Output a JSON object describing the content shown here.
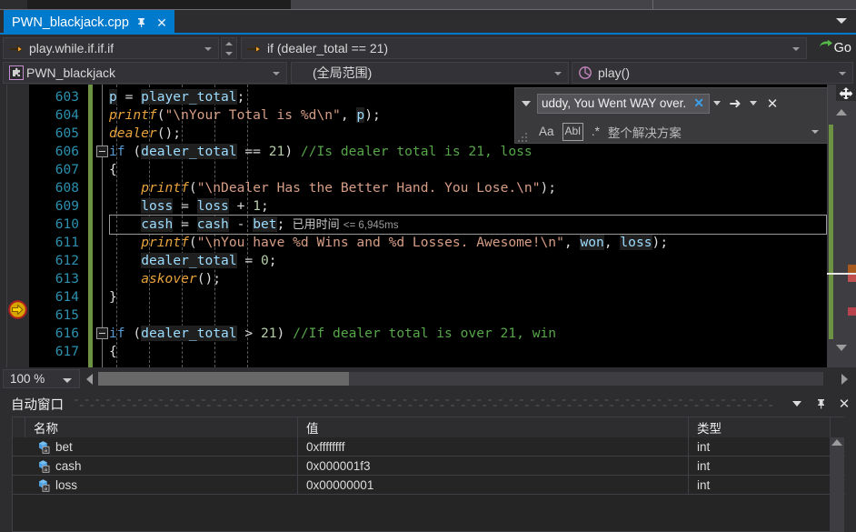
{
  "window": {
    "tab": {
      "title": "PWN_blackjack.cpp",
      "pin_icon": "pin-icon",
      "close_icon": "close-icon"
    },
    "tab_list_caret": "chevron-down-icon"
  },
  "navbar": {
    "row1": {
      "scope_icon": "orange-arrow-icon",
      "scope_value": "play.while.if.if.if",
      "member_icon": "orange-arrow-icon",
      "member_value": "if (dealer_total == 21)",
      "go_label": "Go",
      "go_icon": "green-go-arrow-icon"
    },
    "row2": {
      "project_icon": "project-puzzle-icon",
      "project_value": "PWN_blackjack",
      "scope_value": "(全局范围)",
      "method_icon": "method-icon",
      "method_value": "play()"
    }
  },
  "find": {
    "expand_icon": "chevron-down-icon",
    "query": "uddy, You Went WAY over.",
    "clear_icon": "clear-x-icon",
    "history_icon": "chevron-down-icon",
    "find_next_icon": "arrow-right-icon",
    "options_icon": "chevron-down-icon",
    "close_icon": "close-icon",
    "match_case_label": "Aa",
    "match_word_label": "Abl",
    "regex_label": ".*",
    "scope_label": "整个解决方案",
    "scope_caret_icon": "chevron-down-icon"
  },
  "editor": {
    "zoom_level": "100 %",
    "current_line": 610,
    "breakpoint_line": 610,
    "fold_lines": [
      606,
      616
    ],
    "lines": [
      {
        "n": 603,
        "tokens": [
          {
            "t": "idn",
            "s": "p"
          },
          {
            "t": "pun",
            "s": " = "
          },
          {
            "t": "idn",
            "s": "player_total"
          },
          {
            "t": "pun",
            "s": ";"
          }
        ]
      },
      {
        "n": 604,
        "tokens": [
          {
            "t": "fnc",
            "s": "printf"
          },
          {
            "t": "pun",
            "s": "("
          },
          {
            "t": "str",
            "s": "\"\\nYour Total is %d\\n\""
          },
          {
            "t": "pun",
            "s": ", "
          },
          {
            "t": "idn",
            "s": "p"
          },
          {
            "t": "pun",
            "s": ");"
          }
        ]
      },
      {
        "n": 605,
        "tokens": [
          {
            "t": "fnc",
            "s": "dealer"
          },
          {
            "t": "pun",
            "s": "();"
          }
        ]
      },
      {
        "n": 606,
        "tokens": [
          {
            "t": "kw",
            "s": "if"
          },
          {
            "t": "pun",
            "s": " ("
          },
          {
            "t": "idn",
            "s": "dealer_total"
          },
          {
            "t": "pun",
            "s": " == "
          },
          {
            "t": "num",
            "s": "21"
          },
          {
            "t": "pun",
            "s": ") "
          },
          {
            "t": "cmt",
            "s": "//Is dealer total is 21, loss"
          }
        ]
      },
      {
        "n": 607,
        "tokens": [
          {
            "t": "pun",
            "s": "{"
          }
        ]
      },
      {
        "n": 608,
        "indent": 4,
        "tokens": [
          {
            "t": "fnc",
            "s": "printf"
          },
          {
            "t": "pun",
            "s": "("
          },
          {
            "t": "str",
            "s": "\"\\nDealer Has the Better Hand. You Lose.\\n\""
          },
          {
            "t": "pun",
            "s": ");"
          }
        ]
      },
      {
        "n": 609,
        "indent": 4,
        "tokens": [
          {
            "t": "idn",
            "s": "loss"
          },
          {
            "t": "pun",
            "s": " = "
          },
          {
            "t": "idn",
            "s": "loss"
          },
          {
            "t": "pun",
            "s": " + "
          },
          {
            "t": "num",
            "s": "1"
          },
          {
            "t": "pun",
            "s": ";"
          }
        ]
      },
      {
        "n": 610,
        "indent": 4,
        "tokens": [
          {
            "t": "idn",
            "s": "cash"
          },
          {
            "t": "pun",
            "s": " = "
          },
          {
            "t": "idn",
            "s": "cash"
          },
          {
            "t": "pun",
            "s": " - "
          },
          {
            "t": "idn",
            "s": "bet"
          },
          {
            "t": "pun",
            "s": ";"
          }
        ]
      },
      {
        "n": 611,
        "indent": 4,
        "tokens": [
          {
            "t": "fnc",
            "s": "printf"
          },
          {
            "t": "pun",
            "s": "("
          },
          {
            "t": "str",
            "s": "\"\\nYou have %d Wins and %d Losses. Awesome!\\n\""
          },
          {
            "t": "pun",
            "s": ", "
          },
          {
            "t": "idn",
            "s": "won"
          },
          {
            "t": "pun",
            "s": ", "
          },
          {
            "t": "idn",
            "s": "loss"
          },
          {
            "t": "pun",
            "s": ");"
          }
        ]
      },
      {
        "n": 612,
        "indent": 4,
        "tokens": [
          {
            "t": "idn",
            "s": "dealer_total"
          },
          {
            "t": "pun",
            "s": " = "
          },
          {
            "t": "num",
            "s": "0"
          },
          {
            "t": "pun",
            "s": ";"
          }
        ]
      },
      {
        "n": 613,
        "indent": 4,
        "tokens": [
          {
            "t": "fnc",
            "s": "askover"
          },
          {
            "t": "pun",
            "s": "();"
          }
        ]
      },
      {
        "n": 614,
        "tokens": [
          {
            "t": "pun",
            "s": "}"
          }
        ]
      },
      {
        "n": 615,
        "tokens": []
      },
      {
        "n": 616,
        "tokens": [
          {
            "t": "kw",
            "s": "if"
          },
          {
            "t": "pun",
            "s": " ("
          },
          {
            "t": "idn",
            "s": "dealer_total"
          },
          {
            "t": "pun",
            "s": " > "
          },
          {
            "t": "num",
            "s": "21"
          },
          {
            "t": "pun",
            "s": ") "
          },
          {
            "t": "cmt",
            "s": "//If dealer total is over 21, win"
          }
        ]
      },
      {
        "n": 617,
        "tokens": [
          {
            "t": "pun",
            "s": "{"
          }
        ]
      }
    ],
    "elapsed_label": "已用时间",
    "elapsed_value": "<= 6,945ms"
  },
  "autos": {
    "title": "自动窗口",
    "dropdown_icon": "chevron-down-icon",
    "pin_icon": "pin-icon",
    "close_icon": "close-icon",
    "columns": [
      "名称",
      "值",
      "类型"
    ],
    "rows": [
      {
        "icon": "variable-icon",
        "name": "bet",
        "value": "0xffffffff",
        "type": "int"
      },
      {
        "icon": "variable-icon",
        "name": "cash",
        "value": "0x000001f3",
        "type": "int"
      },
      {
        "icon": "variable-icon",
        "name": "loss",
        "value": "0x00000001",
        "type": "int"
      }
    ]
  },
  "colors": {
    "accent_blue": "#007acc",
    "editor_bg": "#000000",
    "chrome_bg": "#2d2d30",
    "line_number": "#2b91af",
    "keyword": "#569cd6",
    "string": "#d69d85",
    "comment": "#57a64a",
    "function": "#e8a33d",
    "identifier": "#9cdcfe",
    "change_bar_green": "#6d9244"
  }
}
